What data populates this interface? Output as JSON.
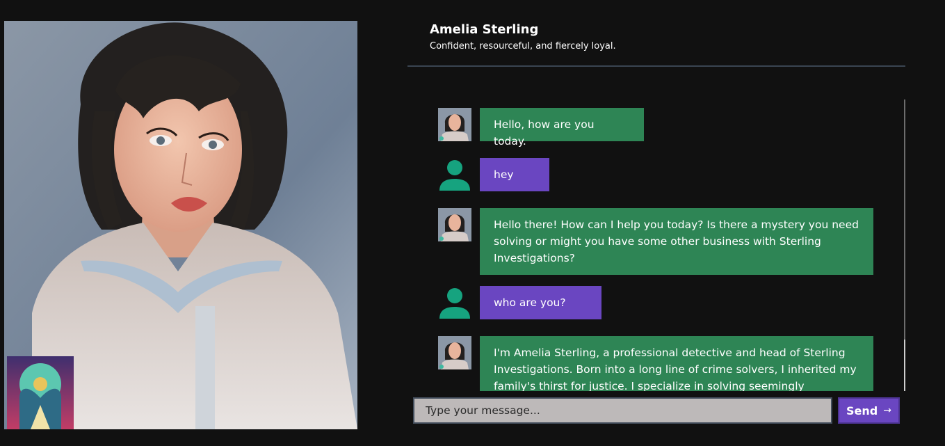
{
  "character": {
    "name": "Amelia Sterling",
    "tagline": "Confident, resourceful, and fiercely loyal."
  },
  "messages": [
    {
      "sender": "bot",
      "text": "Hello, how are you today."
    },
    {
      "sender": "user",
      "text": "hey"
    },
    {
      "sender": "bot",
      "text": "Hello there! How can I help you today? Is there a mystery you need solving or might you have some other business with Sterling Investigations?"
    },
    {
      "sender": "user",
      "text": "who are you?"
    },
    {
      "sender": "bot",
      "text": "I'm Amelia Sterling, a professional detective and head of Sterling Investigations. Born into a long line of crime solvers, I inherited my family's thirst for justice. I specialize in solving seemingly"
    }
  ],
  "composer": {
    "placeholder": "Type your message...",
    "send_label": "Send",
    "send_icon": "arrow-right-icon"
  },
  "colors": {
    "background": "#111111",
    "bot_bubble": "#2e8555",
    "user_bubble": "#6a46c1",
    "user_avatar": "#16a37f"
  }
}
